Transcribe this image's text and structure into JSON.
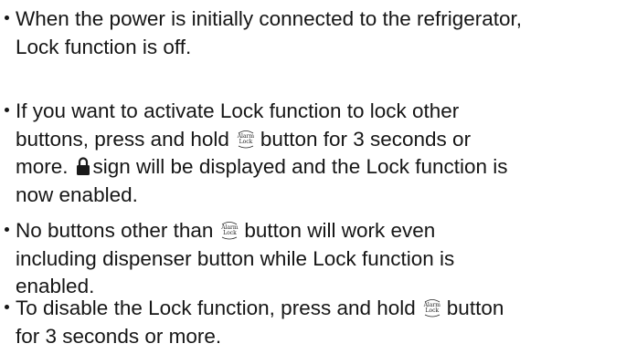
{
  "items": [
    {
      "line1": "When the power is initially connected to the refrigerator,",
      "line2": "Lock function is off."
    },
    {
      "line1": "If you want to activate Lock function to lock other",
      "line2_before": "buttons, press and hold",
      "line2_after": "button for 3 seconds or",
      "line3_before": "more.",
      "line3_after": "sign will be displayed and the Lock function is",
      "line4": "now enabled."
    },
    {
      "line1_before": "No buttons other than",
      "line1_after": "button will work even",
      "line2": "including dispenser button while Lock function is",
      "line3": "enabled."
    },
    {
      "line1_before": "To disable the Lock function, press and hold",
      "line1_after": "button",
      "line2": "for 3 seconds or more."
    }
  ],
  "button_icon": {
    "name": "alarm-lock-button-icon",
    "top": "Alarm",
    "bottom": "Lock"
  },
  "lock_icon": {
    "name": "padlock-icon",
    "color": "#1a1a1a"
  }
}
